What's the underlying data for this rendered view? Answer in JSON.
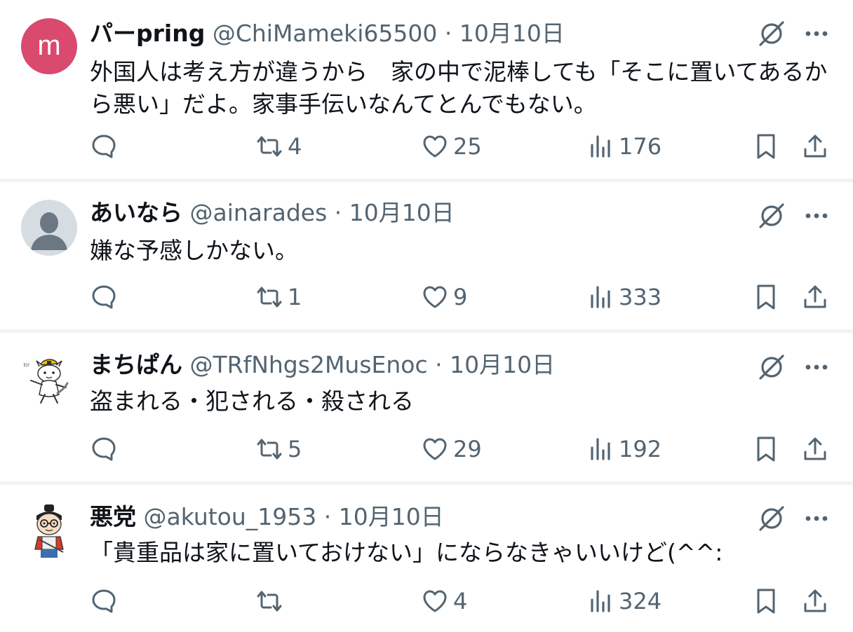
{
  "colors": {
    "text": "#0f1419",
    "muted": "#536471",
    "separator": "#eff3f4",
    "avatar_pink": "#d94a6e"
  },
  "posts": [
    {
      "name": "パーpring",
      "handle": "@ChiMameki65500",
      "dot": "·",
      "date": "10月10日",
      "text": "外国人は考え方が違うから　家の中で泥棒しても「そこに置いてあるから悪い」だよ。家事手伝いなんてとんでもない。",
      "avatar_letter": "m",
      "avatar": "letter-avatar",
      "replies": "",
      "reposts": "4",
      "likes": "25",
      "views": "176"
    },
    {
      "name": "あいなら",
      "handle": "@ainarades",
      "dot": "·",
      "date": "10月10日",
      "text": "嫌な予感しかない。",
      "avatar": "default-avatar",
      "replies": "",
      "reposts": "1",
      "likes": "9",
      "views": "333"
    },
    {
      "name": "まちぱん",
      "handle": "@TRfNhgs2MusEnoc",
      "dot": "·",
      "date": "10月10日",
      "text": "盗まれる・犯される・殺される",
      "avatar": "cat-helmet-avatar",
      "replies": "",
      "reposts": "5",
      "likes": "29",
      "views": "192"
    },
    {
      "name": "悪党",
      "handle": "@akutou_1953",
      "dot": "·",
      "date": "10月10日",
      "text": "「貴重品は家に置いておけない」にならなきゃいいけど(^^:",
      "avatar": "samurai-avatar",
      "replies": "",
      "reposts": "",
      "likes": "4",
      "views": "324"
    }
  ],
  "icons": {
    "reply": "reply-icon",
    "repost": "repost-icon",
    "like": "like-icon",
    "views": "views-icon",
    "bookmark": "bookmark-icon",
    "share": "share-icon",
    "grok": "grok-icon",
    "more": "more-icon"
  }
}
